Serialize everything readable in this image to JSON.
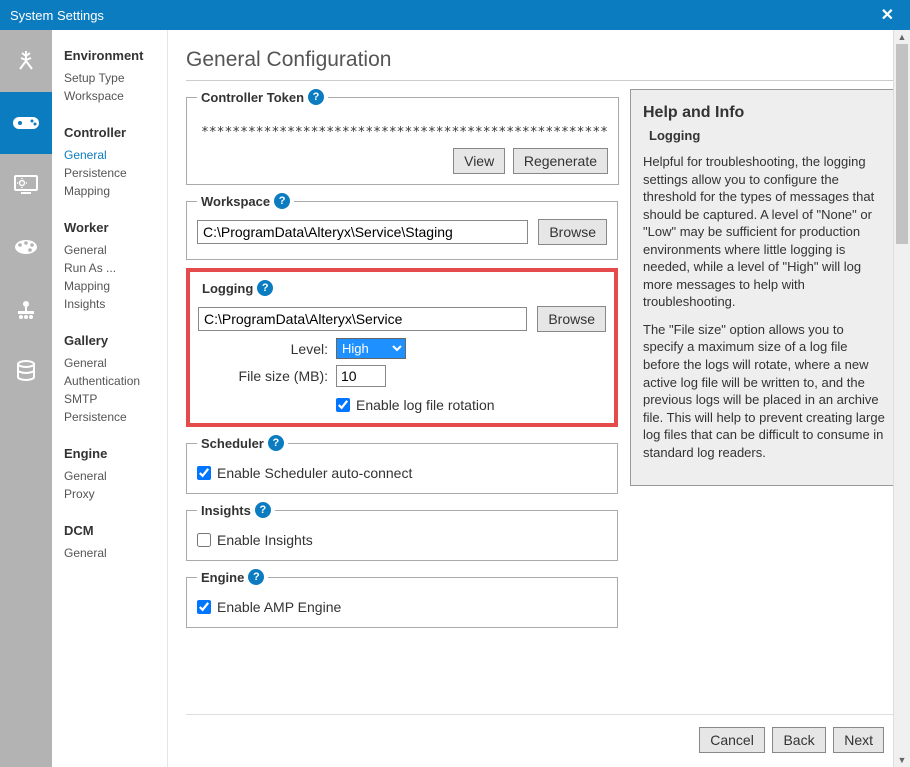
{
  "window": {
    "title": "System Settings"
  },
  "iconbar": [
    {
      "name": "environment",
      "active": false
    },
    {
      "name": "controller",
      "active": true
    },
    {
      "name": "worker",
      "active": false
    },
    {
      "name": "gallery",
      "active": false
    },
    {
      "name": "engine",
      "active": false
    },
    {
      "name": "dcm",
      "active": false
    }
  ],
  "sidebar": {
    "groups": [
      {
        "title": "Environment",
        "items": [
          "Setup Type",
          "Workspace"
        ],
        "activeItem": null
      },
      {
        "title": "Controller",
        "items": [
          "General",
          "Persistence",
          "Mapping"
        ],
        "activeItem": "General"
      },
      {
        "title": "Worker",
        "items": [
          "General",
          "Run As ...",
          "Mapping",
          "Insights"
        ],
        "activeItem": null
      },
      {
        "title": "Gallery",
        "items": [
          "General",
          "Authentication",
          "SMTP",
          "Persistence"
        ],
        "activeItem": null
      },
      {
        "title": "Engine",
        "items": [
          "General",
          "Proxy"
        ],
        "activeItem": null
      },
      {
        "title": "DCM",
        "items": [
          "General"
        ],
        "activeItem": null
      }
    ]
  },
  "page": {
    "title": "General Configuration"
  },
  "controllerToken": {
    "legend": "Controller Token",
    "value": "****************************************************",
    "viewLabel": "View",
    "regenerateLabel": "Regenerate"
  },
  "workspace": {
    "legend": "Workspace",
    "path": "C:\\ProgramData\\Alteryx\\Service\\Staging",
    "browseLabel": "Browse"
  },
  "logging": {
    "legend": "Logging",
    "path": "C:\\ProgramData\\Alteryx\\Service",
    "browseLabel": "Browse",
    "levelLabel": "Level:",
    "levelValue": "High",
    "fileSizeLabel": "File size (MB):",
    "fileSizeValue": "10",
    "enableRotationLabel": "Enable log file rotation",
    "enableRotationChecked": true
  },
  "scheduler": {
    "legend": "Scheduler",
    "enableLabel": "Enable Scheduler auto-connect",
    "enableChecked": true
  },
  "insights": {
    "legend": "Insights",
    "enableLabel": "Enable Insights",
    "enableChecked": false
  },
  "engine": {
    "legend": "Engine",
    "enableLabel": "Enable AMP Engine",
    "enableChecked": true
  },
  "help": {
    "title": "Help and Info",
    "subtitle": "Logging",
    "p1": "Helpful for troubleshooting, the logging settings allow you to configure the threshold for the types of messages that should be captured. A level of \"None\" or \"Low\" may be sufficient for production environments where little logging is needed, while a level of \"High\" will log more messages to help with troubleshooting.",
    "p2": "The \"File size\" option allows you to specify a maximum size of a log file before the logs will rotate, where a new active log file will be written to, and the previous logs will be placed in an archive file. This will help to prevent creating large log files that can be difficult to consume in standard log readers."
  },
  "footer": {
    "cancel": "Cancel",
    "back": "Back",
    "next": "Next"
  }
}
